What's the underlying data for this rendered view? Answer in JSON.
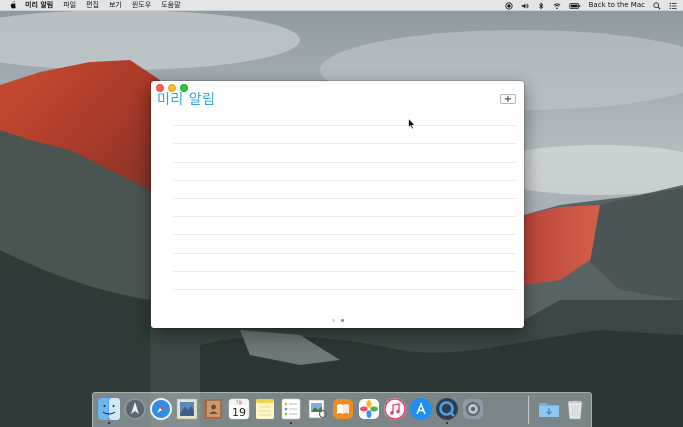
{
  "menubar": {
    "app_name": "미리 알림",
    "items": [
      "파일",
      "편집",
      "보기",
      "윈도우",
      "도움말"
    ],
    "back_to_mac": "Back to the Mac"
  },
  "window": {
    "title": "미리 알림",
    "add_button": "+",
    "row_count": 10,
    "page_count": 2,
    "active_page": 2
  },
  "dock": {
    "apps": [
      {
        "icon": "finder-icon",
        "running": true
      },
      {
        "icon": "launchpad-icon",
        "running": false
      },
      {
        "icon": "safari-icon",
        "running": false
      },
      {
        "icon": "mail-stamp-icon",
        "running": false
      },
      {
        "icon": "contacts-icon",
        "running": false
      },
      {
        "icon": "calendar-icon",
        "label": "19",
        "month": "7월",
        "running": false
      },
      {
        "icon": "notes-icon",
        "running": false
      },
      {
        "icon": "reminders-icon",
        "running": true
      },
      {
        "icon": "preview-icon",
        "running": false
      },
      {
        "icon": "ibooks-icon",
        "running": false
      },
      {
        "icon": "photos-icon",
        "running": false
      },
      {
        "icon": "itunes-icon",
        "running": false
      },
      {
        "icon": "app-store-icon",
        "running": false
      },
      {
        "icon": "quicktime-icon",
        "running": true
      },
      {
        "icon": "system-preferences-icon",
        "running": false
      },
      {
        "icon": "downloads-folder-icon",
        "running": false
      },
      {
        "icon": "trash-icon",
        "running": false
      }
    ]
  },
  "colors": {
    "title_accent": "#2ea6d9",
    "close": "#fc5f57",
    "minimize": "#fdbc2e",
    "maximize": "#28c840"
  }
}
